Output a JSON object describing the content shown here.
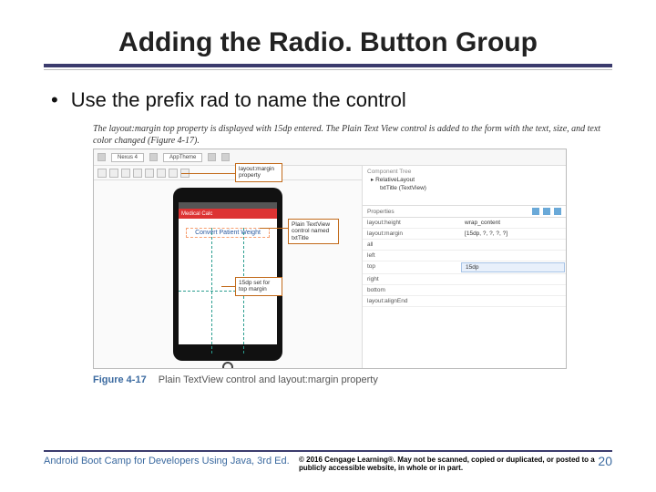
{
  "title": "Adding the Radio. Button Group",
  "bullet": "Use the prefix rad to name the control",
  "caption": "The layout:margin top property is displayed with 15dp entered. The Plain Text View control is added to the form with the text, size, and text color changed (Figure 4-17).",
  "toolbar": {
    "device": "Nexus 4",
    "api": "AppTheme"
  },
  "phone": {
    "app_label": "Medical Calc",
    "text_title": "Convert Patient Weight"
  },
  "callouts": {
    "c1": "Plain TextView control named txtTitle",
    "c2": "layout:margin property",
    "c3": "15dp set for top margin"
  },
  "tree": {
    "h": "Component Tree",
    "l1": "RelativeLayout",
    "l2": "txtTitle (TextView)"
  },
  "props": {
    "head": "Properties",
    "rows": [
      {
        "k": "layout:height",
        "v": "wrap_content"
      },
      {
        "k": "layout:margin",
        "v": "[15dp, ?, ?, ?, ?]"
      },
      {
        "k": "all",
        "v": ""
      },
      {
        "k": "left",
        "v": ""
      },
      {
        "k": "top",
        "v": "15dp"
      },
      {
        "k": "right",
        "v": ""
      },
      {
        "k": "bottom",
        "v": ""
      },
      {
        "k": "layout:alignEnd",
        "v": ""
      }
    ]
  },
  "figure": {
    "num": "Figure 4-17",
    "desc": "Plain TextView control and layout:margin property"
  },
  "footer": {
    "book": "Android Boot Camp for Developers Using Java, 3rd Ed.",
    "copy": "© 2016 Cengage Learning®. May not be scanned, copied or duplicated, or posted to a publicly accessible website, in whole or in part.",
    "page": "20"
  }
}
